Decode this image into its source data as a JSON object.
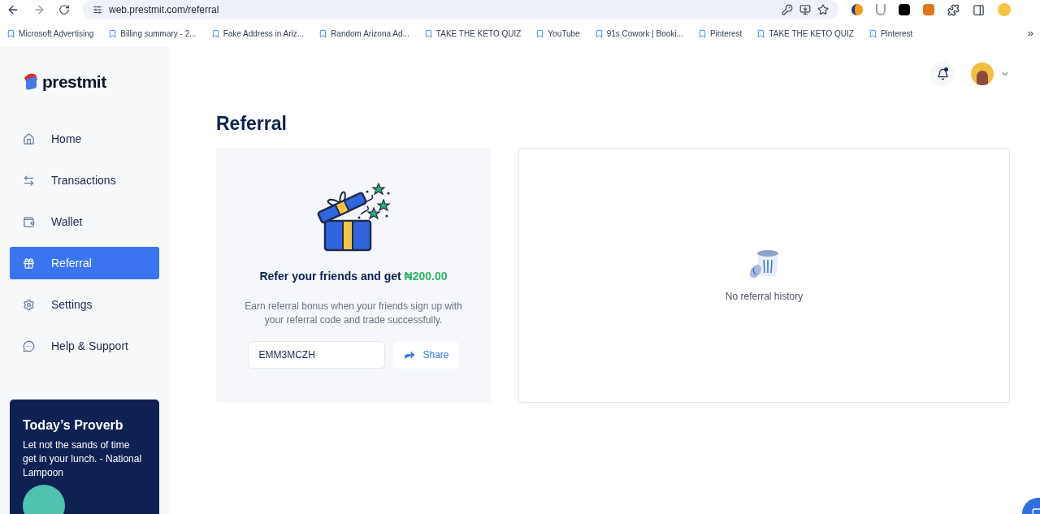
{
  "browser": {
    "url": "web.prestmit.com/referral",
    "bookmarks": [
      {
        "label": "Microsoft Advertising"
      },
      {
        "label": "Billing summary - 2..."
      },
      {
        "label": "Fake Address in Ariz..."
      },
      {
        "label": "Random Arizona Ad..."
      },
      {
        "label": "TAKE THE KETO QUIZ"
      },
      {
        "label": "YouTube"
      },
      {
        "label": "91s Cowork | Booki..."
      },
      {
        "label": "Pinterest"
      },
      {
        "label": "TAKE THE KETO QUIZ"
      },
      {
        "label": "Pinterest"
      }
    ],
    "more": "»"
  },
  "sidebar": {
    "logo": "prestmit",
    "items": [
      {
        "label": "Home",
        "selected": false
      },
      {
        "label": "Transactions",
        "selected": false
      },
      {
        "label": "Wallet",
        "selected": false
      },
      {
        "label": "Referral",
        "selected": true
      },
      {
        "label": "Settings",
        "selected": false
      },
      {
        "label": "Help & Support",
        "selected": false
      }
    ],
    "proverb": {
      "title": "Today’s Proverb",
      "text": "Let not the sands of time get in your lunch. - National Lampoon"
    }
  },
  "header": {
    "notification_unread": true
  },
  "page": {
    "title": "Referral",
    "referral_card": {
      "heading": "Refer your friends and get",
      "amount": "₦200.00",
      "description": "Earn referral bonus when your friends sign up with your referral code and trade successfully.",
      "code": "EMM3MCZH",
      "share_button": "Share"
    },
    "history": {
      "empty_text": "No referral history"
    }
  }
}
